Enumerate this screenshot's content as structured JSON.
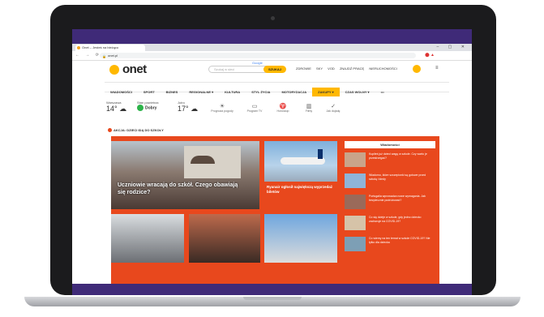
{
  "browser": {
    "tab_title": "Onet – Jesteś na bieżąco",
    "url": "onet.pl",
    "window_controls": "– ▢ ✕",
    "nav_buttons": "← → ⟳"
  },
  "header": {
    "logo": "onet",
    "search_placeholder": "Szukaj w sieci",
    "search_engine": "Google",
    "search_button": "SZUKAJ",
    "top_icons": [
      "ZDROWIE",
      "SKY",
      "VOD",
      "ZNAJDŹ PRACĘ",
      "NIERUCHOMOŚCI"
    ],
    "mail_label": "MAIL"
  },
  "nav": {
    "items": [
      "WIADOMOŚCI",
      "SPORT",
      "BIZNES",
      "REGIONALNE ▾",
      "KULTURA",
      "STYL ŻYCIA",
      "MOTORYZACJA",
      "ZAKUPY ▾",
      "CZAS WOLNY ▾",
      "•••"
    ],
    "highlighted_index": 7
  },
  "weather": {
    "city": "Warszawa",
    "temp_now": "14°",
    "air_label": "Stan powietrza",
    "air_value": "Dobry",
    "tomorrow_label": "Jutro",
    "temp_tomorrow": "17°",
    "services": [
      {
        "icon": "☀",
        "label": "Prognoza pogody"
      },
      {
        "icon": "▭",
        "label": "Program TV"
      },
      {
        "icon": "♈",
        "label": "Horoskop"
      },
      {
        "icon": "▥",
        "label": "Filmy"
      },
      {
        "icon": "✓",
        "label": "Jak dojadę"
      }
    ]
  },
  "section": {
    "title": "AKCJA: DZIECI IDĄ DO SZKOŁY"
  },
  "main": {
    "hero_caption": "Uczniowie wracają do szkół. Czego obawiają się rodzice?",
    "plane_caption": "Ryanair ogłosił największą wyprzedaż biletów",
    "side_header": "Wiadomości",
    "side_items": [
      {
        "text": "Kupiłeś już dzieci wagę w szkole. Czy warto je przestrzegać?",
        "color": "#c9a48a"
      },
      {
        "text": "Wiadomo, które szczepionki są gotowe przed szkołą i kiedy",
        "color": "#8fb4d8"
      },
      {
        "text": "Portugalia wprowadza nowe wymagania. Jak bezpiecznie podróżować?",
        "color": "#9a6a5a"
      },
      {
        "text": "Co się dzieje w szkole, gdy jedno dziecko zachoruje na COVID-19?",
        "color": "#d6c3a8"
      },
      {
        "text": "Co wiemy na ten temat w szkole COVID-19? Nie tylko dla dziecka",
        "color": "#7d9fb5"
      }
    ]
  },
  "colors": {
    "accent": "#ffb800",
    "tile_bg": "#e8481d",
    "screen_frame": "#3f2a78"
  }
}
